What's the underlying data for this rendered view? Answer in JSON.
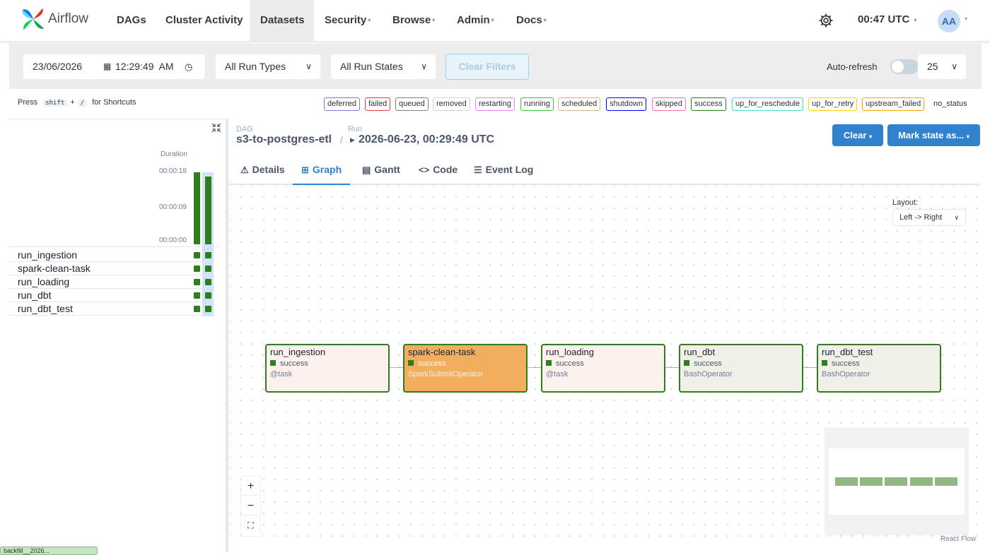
{
  "nav": {
    "logo_text": "Airflow",
    "items": [
      "DAGs",
      "Cluster Activity",
      "Datasets",
      "Security",
      "Browse",
      "Admin",
      "Docs"
    ],
    "time": "00:47 UTC",
    "user_initials": "AA"
  },
  "filters": {
    "date": "23/06/2026",
    "time": "12:29:49  AM",
    "run_types": "All Run Types",
    "run_states": "All Run States",
    "clear_label": "Clear Filters",
    "auto_refresh_label": "Auto-refresh",
    "page_size": "25"
  },
  "shortcuts": {
    "press": "Press",
    "key1": "shift",
    "plus": "+",
    "key2": "/",
    "suffix": "for Shortcuts"
  },
  "legend": [
    "deferred",
    "failed",
    "queued",
    "removed",
    "restarting",
    "running",
    "scheduled",
    "shutdown",
    "skipped",
    "success",
    "up_for_reschedule",
    "up_for_retry",
    "upstream_failed",
    "no_status"
  ],
  "legend_colors": {
    "deferred": "#9370db",
    "failed": "#e53e3e",
    "queued": "#808080",
    "removed": "#d3d3d3",
    "restarting": "#ee82ee",
    "running": "#32cd32",
    "scheduled": "#d2b48c",
    "shutdown": "#0000ff",
    "skipped": "#ff69b4",
    "success": "#2e7d1f",
    "up_for_reschedule": "#40e0d0",
    "up_for_retry": "#ffd700",
    "upstream_failed": "#ffa500",
    "no_status": "transparent"
  },
  "grid": {
    "duration_label": "Duration",
    "ticks": [
      "00:00:18",
      "00:00:09",
      "00:00:00"
    ],
    "run_durations_sec": [
      18,
      17
    ],
    "tasks": [
      "run_ingestion",
      "spark-clean-task",
      "run_loading",
      "run_dbt",
      "run_dbt_test"
    ],
    "bottom_tag": "backfill__2026..."
  },
  "header": {
    "dag_label": "DAG",
    "dag_id": "s3-to-postgres-etl",
    "run_label": "Run",
    "run_id": "2026-06-23, 00:29:49 UTC",
    "clear_button": "Clear",
    "mark_state_button": "Mark state as..."
  },
  "tabs": [
    {
      "label": "Details",
      "icon": "warning-icon"
    },
    {
      "label": "Graph",
      "icon": "graph-icon"
    },
    {
      "label": "Gantt",
      "icon": "gantt-icon"
    },
    {
      "label": "Code",
      "icon": "code-icon"
    },
    {
      "label": "Event Log",
      "icon": "event-log-icon"
    }
  ],
  "graph": {
    "layout_label": "Layout:",
    "layout_value": "Left -> Right",
    "nodes": [
      {
        "name": "run_ingestion",
        "state": "success",
        "operator": "@task",
        "bg": "#fdf1ee"
      },
      {
        "name": "spark-clean-task",
        "state": "success",
        "operator": "SparkSubmitOperator",
        "bg": "#f2ad5f"
      },
      {
        "name": "run_loading",
        "state": "success",
        "operator": "@task",
        "bg": "#fdf1ee"
      },
      {
        "name": "run_dbt",
        "state": "success",
        "operator": "BashOperator",
        "bg": "#f0f0e8"
      },
      {
        "name": "run_dbt_test",
        "state": "success",
        "operator": "BashOperator",
        "bg": "#f0f0e8"
      }
    ],
    "zoom_in": "+",
    "zoom_out": "−",
    "fit": "⛶",
    "attribution": "React Flow"
  }
}
